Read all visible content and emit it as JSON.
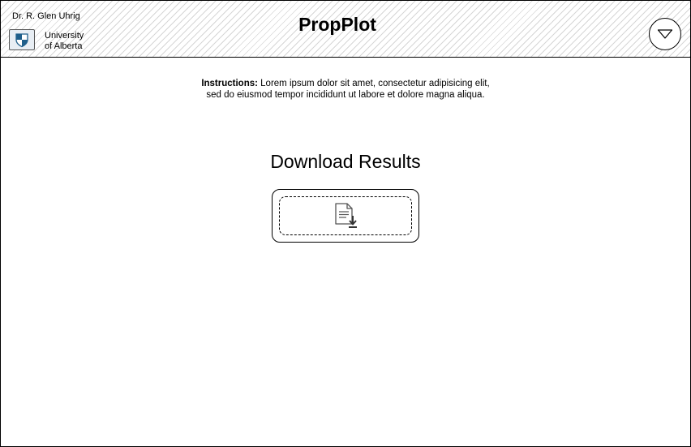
{
  "header": {
    "author": "Dr. R. Glen Uhrig",
    "institution_line1": "University",
    "institution_line2": "of Alberta",
    "app_title": "PropPlot",
    "logo_icon": "shield-logo-icon",
    "menu_icon": "triangle-down-icon"
  },
  "main": {
    "instructions_label": "Instructions:",
    "instructions_line1": "Lorem ipsum dolor sit amet, consectetur adipisicing elit,",
    "instructions_line2": "sed do eiusmod tempor incididunt ut labore et dolore magna aliqua.",
    "section_heading": "Download Results",
    "download_icon": "file-download-icon"
  },
  "colors": {
    "logo_blue": "#1f5f8b",
    "border": "#000000",
    "header_hatch": "#d6d6d6"
  }
}
